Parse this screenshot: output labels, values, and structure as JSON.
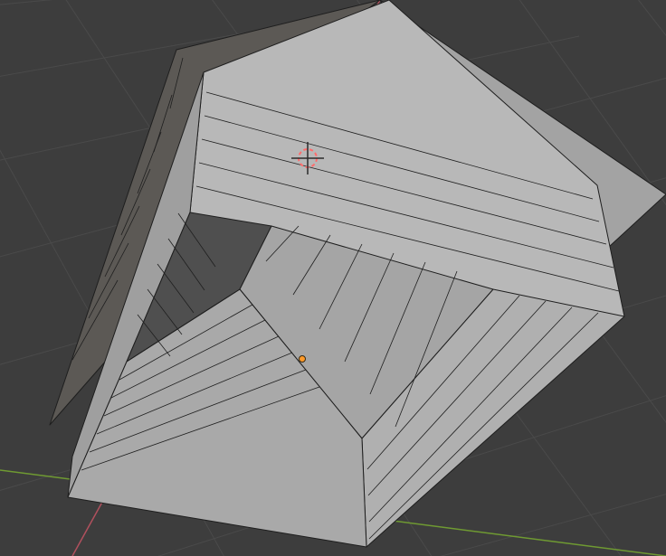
{
  "app": "3D Viewport",
  "viewport": {
    "background_color": "#3d3d3d",
    "grid_color": "#4a4a4a",
    "x_axis_color": "#b0505d",
    "y_axis_color": "#6f9a32"
  },
  "scene": {
    "object_type": "mesh",
    "shape": "roof-like faceted mesh",
    "face_color": "#a9a9a9",
    "edge_color": "#1e1e1e",
    "has_3d_cursor": true,
    "has_origin_point": true,
    "origin_point_color": "#ff9a2a"
  }
}
